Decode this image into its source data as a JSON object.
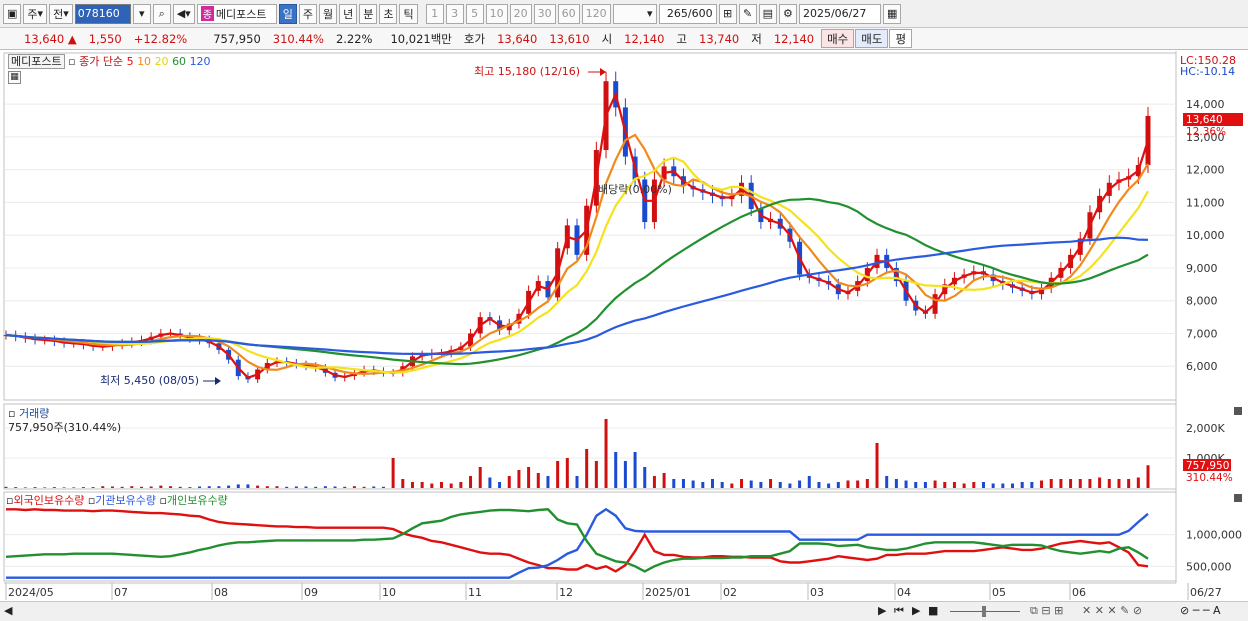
{
  "toolbar": {
    "market_label": "주",
    "prev_label": "전",
    "code": "078160",
    "name_badge": "종",
    "name": "메디포스트",
    "periods": [
      "일",
      "주",
      "월",
      "년",
      "분",
      "초",
      "틱"
    ],
    "selected_period": "일",
    "minutes": [
      "1",
      "3",
      "5",
      "10",
      "20",
      "30",
      "60",
      "120"
    ],
    "count": "265",
    "count_max": "/600",
    "date": "2025/06/27"
  },
  "quote": {
    "price": "13,640",
    "arrow": "▲",
    "change": "1,550",
    "change_pct": "+12.82%",
    "volume": "757,950",
    "volume_pct": "310.44%",
    "turnover_pct": "2.22%",
    "value": "10,021백만",
    "ask_label": "호가",
    "ask": "13,640",
    "bid": "13,610",
    "open_label": "시",
    "open": "12,140",
    "high_label": "고",
    "high": "13,740",
    "low_label": "저",
    "low": "12,140",
    "buy_label": "매수",
    "sell_label": "매도",
    "eval_label": "평"
  },
  "price_pane": {
    "stock_label": "메디포스트",
    "ma_title": "종가 단순",
    "ma_periods": [
      "5",
      "10",
      "20",
      "60",
      "120"
    ],
    "ma_colors": [
      "#e01010",
      "#f08a1c",
      "#f4e21c",
      "#229030",
      "#2a5ae0"
    ],
    "lc": "LC:150.28",
    "hc": "HC:-10.14",
    "high_annotation": "최고 15,180 (12/16)",
    "low_annotation": "최저 5,450 (08/05)",
    "mid_annotation": "배당락(0.00%)",
    "current_price_label": "13,640",
    "current_pct_label": "12.36%",
    "up_color": "#d01010",
    "down_color": "#1a4ad0"
  },
  "volume_pane": {
    "title": "거래량",
    "subtitle": "757,950주(310.44%)",
    "current_label": "757,950",
    "current_pct_label": "310.44%"
  },
  "holdings_pane": {
    "legends": [
      "외국인보유수량",
      "기관보유수량",
      "개인보유수량"
    ],
    "legend_colors": [
      "#e01010",
      "#2a5ae0",
      "#229030"
    ]
  },
  "chart_data": [
    {
      "type": "candlestick",
      "title": "메디포스트",
      "x": [
        "2024/05",
        "07",
        "08",
        "09",
        "10",
        "11",
        "12",
        "2025/01",
        "02",
        "03",
        "04",
        "05",
        "06",
        "06/27"
      ],
      "ylim": [
        5000,
        15500
      ],
      "y_ticks": [
        6000,
        7000,
        8000,
        9000,
        10000,
        11000,
        12000,
        13000,
        14000
      ],
      "close_series": [
        6950,
        6900,
        6850,
        6800,
        6800,
        6750,
        6700,
        6700,
        6650,
        6600,
        6600,
        6650,
        6700,
        6750,
        6800,
        6900,
        7000,
        7000,
        6900,
        6850,
        6800,
        6700,
        6500,
        6200,
        5700,
        5600,
        5900,
        6100,
        6150,
        6100,
        6050,
        6000,
        5950,
        5800,
        5650,
        5700,
        5800,
        5900,
        5850,
        5800,
        5800,
        6000,
        6300,
        6350,
        6400,
        6400,
        6500,
        6600,
        7000,
        7500,
        7400,
        7100,
        7300,
        7600,
        8300,
        8600,
        8100,
        9600,
        10300,
        9400,
        10900,
        12600,
        14700,
        13900,
        12400,
        11700,
        10400,
        11700,
        12100,
        11800,
        11500,
        11400,
        11300,
        11200,
        11100,
        11200,
        11600,
        10800,
        10400,
        10500,
        10200,
        9800,
        8800,
        8700,
        8600,
        8500,
        8200,
        8300,
        8600,
        9000,
        9400,
        9000,
        8600,
        8000,
        7700,
        7600,
        8200,
        8500,
        8700,
        8800,
        8900,
        8800,
        8600,
        8500,
        8400,
        8300,
        8200,
        8400,
        8700,
        9000,
        9400,
        9900,
        10700,
        11200,
        11600,
        11700,
        11800,
        12140,
        13640
      ],
      "ma": {
        "5": "red",
        "10": "orange",
        "20": "yellow",
        "60": "green",
        "120": "blue"
      },
      "annotations": [
        "최고 15,180 (12/16)",
        "최저 5,450 (08/05)",
        "배당락(0.00%)"
      ],
      "last": 13640,
      "last_pct": "12.36%"
    },
    {
      "type": "bar",
      "title": "거래량",
      "y_ticks": [
        "1,000K",
        "2,000K"
      ],
      "ylim": [
        0,
        2500000
      ],
      "values": [
        40000,
        30000,
        20000,
        30000,
        20000,
        30000,
        20000,
        20000,
        30000,
        30000,
        60000,
        50000,
        40000,
        60000,
        40000,
        50000,
        80000,
        60000,
        40000,
        30000,
        50000,
        60000,
        60000,
        80000,
        120000,
        120000,
        80000,
        60000,
        60000,
        40000,
        50000,
        50000,
        40000,
        60000,
        50000,
        40000,
        60000,
        40000,
        50000,
        40000,
        1000000,
        300000,
        200000,
        200000,
        150000,
        200000,
        150000,
        200000,
        400000,
        700000,
        350000,
        200000,
        400000,
        600000,
        700000,
        500000,
        400000,
        900000,
        1000000,
        400000,
        1300000,
        900000,
        2300000,
        1200000,
        900000,
        1200000,
        700000,
        400000,
        500000,
        300000,
        300000,
        250000,
        200000,
        300000,
        200000,
        150000,
        300000,
        250000,
        200000,
        300000,
        200000,
        150000,
        250000,
        400000,
        200000,
        150000,
        200000,
        250000,
        250000,
        300000,
        1500000,
        400000,
        300000,
        250000,
        200000,
        200000,
        250000,
        200000,
        200000,
        150000,
        200000,
        200000,
        150000,
        150000,
        150000,
        200000,
        200000,
        250000,
        300000,
        300000,
        300000,
        300000,
        300000,
        350000,
        300000,
        300000,
        300000,
        350000,
        757950
      ]
    },
    {
      "type": "line",
      "series": [
        {
          "name": "외국인보유수량",
          "color": "#e01010"
        },
        {
          "name": "기관보유수량",
          "color": "#2a5ae0"
        },
        {
          "name": "개인보유수량",
          "color": "#229030"
        }
      ],
      "y_ticks": [
        "500,000",
        "1,000,000"
      ],
      "ylim": [
        300000,
        1500000
      ],
      "foreign": [
        1400000,
        1400000,
        1390000,
        1400000,
        1390000,
        1390000,
        1380000,
        1380000,
        1380000,
        1370000,
        1380000,
        1380000,
        1370000,
        1360000,
        1350000,
        1340000,
        1340000,
        1330000,
        1320000,
        1300000,
        1290000,
        1240000,
        1200000,
        1180000,
        1170000,
        1160000,
        1150000,
        1140000,
        1130000,
        1130000,
        1120000,
        1120000,
        1110000,
        1110000,
        1110000,
        1110000,
        1110000,
        1110000,
        1110000,
        1110000,
        1090000,
        1020000,
        980000,
        950000,
        900000,
        880000,
        840000,
        800000,
        760000,
        720000,
        700000,
        700000,
        680000,
        620000,
        560000,
        520000,
        470000,
        470000,
        450000,
        450000,
        520000,
        460000,
        500000,
        420000,
        520000,
        740000,
        1000000,
        740000,
        680000,
        680000,
        650000,
        640000,
        640000,
        660000,
        660000,
        650000,
        650000,
        640000,
        640000,
        640000,
        580000,
        560000,
        560000,
        580000,
        600000,
        620000,
        660000,
        640000,
        620000,
        600000,
        620000,
        680000,
        680000,
        700000,
        700000,
        700000,
        720000,
        740000,
        740000,
        740000,
        740000,
        760000,
        780000,
        800000,
        780000,
        760000,
        760000,
        780000,
        820000,
        860000,
        880000,
        900000,
        880000,
        860000,
        880000,
        800000,
        720000,
        520000,
        500000
      ],
      "institution": [
        320000,
        320000,
        320000,
        320000,
        320000,
        320000,
        320000,
        320000,
        320000,
        320000,
        320000,
        320000,
        320000,
        320000,
        320000,
        320000,
        320000,
        320000,
        320000,
        320000,
        320000,
        320000,
        320000,
        320000,
        320000,
        320000,
        320000,
        320000,
        320000,
        320000,
        320000,
        320000,
        320000,
        320000,
        320000,
        320000,
        320000,
        320000,
        320000,
        320000,
        320000,
        320000,
        320000,
        320000,
        320000,
        320000,
        320000,
        320000,
        320000,
        320000,
        320000,
        320000,
        320000,
        400000,
        470000,
        480000,
        520000,
        600000,
        700000,
        760000,
        1000000,
        1300000,
        1400000,
        1300000,
        1100000,
        1060000,
        1050000,
        1050000,
        1050000,
        1050000,
        1050000,
        1050000,
        1050000,
        1050000,
        1050000,
        1050000,
        1050000,
        1050000,
        1050000,
        1050000,
        1050000,
        1050000,
        920000,
        920000,
        920000,
        920000,
        920000,
        920000,
        920000,
        1000000,
        1000000,
        1000000,
        1000000,
        1000000,
        1000000,
        1000000,
        1000000,
        1000000,
        1000000,
        1000000,
        1000000,
        1000000,
        1000000,
        1000000,
        1000000,
        1000000,
        1000000,
        1000000,
        1000000,
        1000000,
        1000000,
        1000000,
        1000000,
        1000000,
        1000000,
        1000000,
        1060000,
        1200000,
        1330000
      ],
      "individual": [
        650000,
        660000,
        670000,
        680000,
        690000,
        690000,
        690000,
        700000,
        700000,
        700000,
        700000,
        700000,
        690000,
        680000,
        670000,
        660000,
        650000,
        660000,
        690000,
        720000,
        760000,
        790000,
        830000,
        860000,
        880000,
        880000,
        890000,
        900000,
        910000,
        910000,
        910000,
        910000,
        910000,
        910000,
        910000,
        910000,
        910000,
        920000,
        920000,
        930000,
        940000,
        1010000,
        1100000,
        1180000,
        1200000,
        1220000,
        1280000,
        1320000,
        1340000,
        1360000,
        1380000,
        1390000,
        1390000,
        1380000,
        1370000,
        1390000,
        1400000,
        1240000,
        1180000,
        1160000,
        900000,
        700000,
        640000,
        580000,
        560000,
        500000,
        420000,
        500000,
        560000,
        600000,
        620000,
        620000,
        630000,
        630000,
        630000,
        640000,
        640000,
        660000,
        660000,
        660000,
        700000,
        740000,
        860000,
        860000,
        860000,
        850000,
        820000,
        830000,
        840000,
        800000,
        780000,
        760000,
        760000,
        780000,
        820000,
        860000,
        880000,
        880000,
        880000,
        880000,
        880000,
        860000,
        840000,
        820000,
        840000,
        840000,
        840000,
        830000,
        780000,
        740000,
        720000,
        700000,
        720000,
        740000,
        720000,
        780000,
        800000,
        720000,
        620000
      ]
    }
  ],
  "x_axis": {
    "labels": [
      "2024/05",
      "07",
      "08",
      "09",
      "10",
      "11",
      "12",
      "2025/01",
      "02",
      "03",
      "04",
      "05",
      "06",
      "06/27"
    ]
  }
}
